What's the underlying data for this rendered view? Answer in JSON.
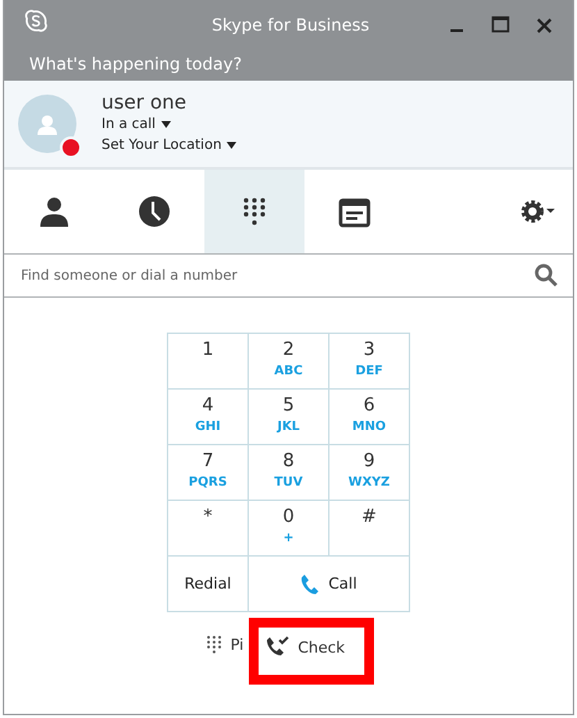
{
  "window": {
    "title": "Skype for Business"
  },
  "note": {
    "placeholder": "What's happening today?"
  },
  "profile": {
    "name": "user one",
    "status": "In a call",
    "busy": true,
    "location": "Set Your Location"
  },
  "tabs": [
    {
      "kind": "contacts",
      "selected": false
    },
    {
      "kind": "recent",
      "selected": false
    },
    {
      "kind": "dialpad",
      "selected": true
    },
    {
      "kind": "meetings",
      "selected": false
    }
  ],
  "search": {
    "placeholder": "Find someone or dial a number"
  },
  "keypad": [
    {
      "digit": "1"
    },
    {
      "digit": "2",
      "letters": "ABC"
    },
    {
      "digit": "3",
      "letters": "DEF"
    },
    {
      "digit": "4",
      "letters": "GHI"
    },
    {
      "digit": "5",
      "letters": "JKL"
    },
    {
      "digit": "6",
      "letters": "MNO"
    },
    {
      "digit": "7",
      "letters": "PQRS"
    },
    {
      "digit": "8",
      "letters": "TUV"
    },
    {
      "digit": "9",
      "letters": "WXYZ"
    },
    {
      "digit": "*"
    },
    {
      "digit": "0",
      "letters": "+"
    },
    {
      "digit": "#"
    }
  ],
  "redial": "Redial",
  "call": "Call",
  "pin": "Pi",
  "check": "Check",
  "highlight": {
    "on": true
  }
}
